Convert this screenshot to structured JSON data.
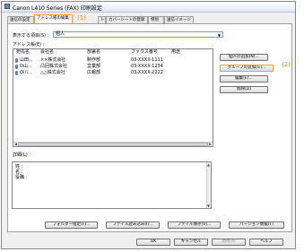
{
  "window": {
    "title": "Canon L410 Series (FAX) 印刷設定"
  },
  "tabs": [
    {
      "label": "送信の設定"
    },
    {
      "label": "アドレス帳の編集",
      "active": true
    },
    {
      "label": "ト"
    },
    {
      "label": "カバーシートの登録"
    },
    {
      "label": "特別"
    },
    {
      "label": "送信イメージ"
    }
  ],
  "callouts": {
    "one": "(1)",
    "two": "(2)"
  },
  "display_item": {
    "label": "表示する項目(S) :",
    "value": "個人"
  },
  "address_list": {
    "label": "アドレス帳(E) :",
    "columns": [
      "宛先名",
      "会社名",
      "部署名",
      "ファクス番号",
      "用途"
    ],
    "rows": [
      [
        "山田...",
        "××株式会社",
        "制作部",
        "03-XXXX-1111",
        ""
      ],
      [
        "O山...",
        "凸回株式会社",
        "営業部",
        "03-XXXX-1234",
        ""
      ],
      [
        "O川...",
        "△△株式会社",
        "広報部",
        "03-XXXX-2222",
        ""
      ]
    ]
  },
  "side_buttons": {
    "add_person": "個人の追加(N)...",
    "add_group": "グループの追加(G)...",
    "edit": "編集(E)...",
    "delete": "削除(D)"
  },
  "details": {
    "label": "詳細(L) :",
    "lines": [
      "姓 :",
      "名 :",
      "役職 :"
    ]
  },
  "bottom_buttons": {
    "folder": "フォルダー指定(F)...",
    "read": "ファイル読み込み(I)...",
    "save": "ファイル保存(V)...",
    "version": "バージョン情報(T)"
  },
  "dialog_buttons": {
    "ok": "OK",
    "cancel": "キャンセル",
    "apply": "適用(A)",
    "help": "ヘルプ"
  },
  "colors": {
    "highlight": "#f0a030",
    "callout": "#f08000"
  }
}
